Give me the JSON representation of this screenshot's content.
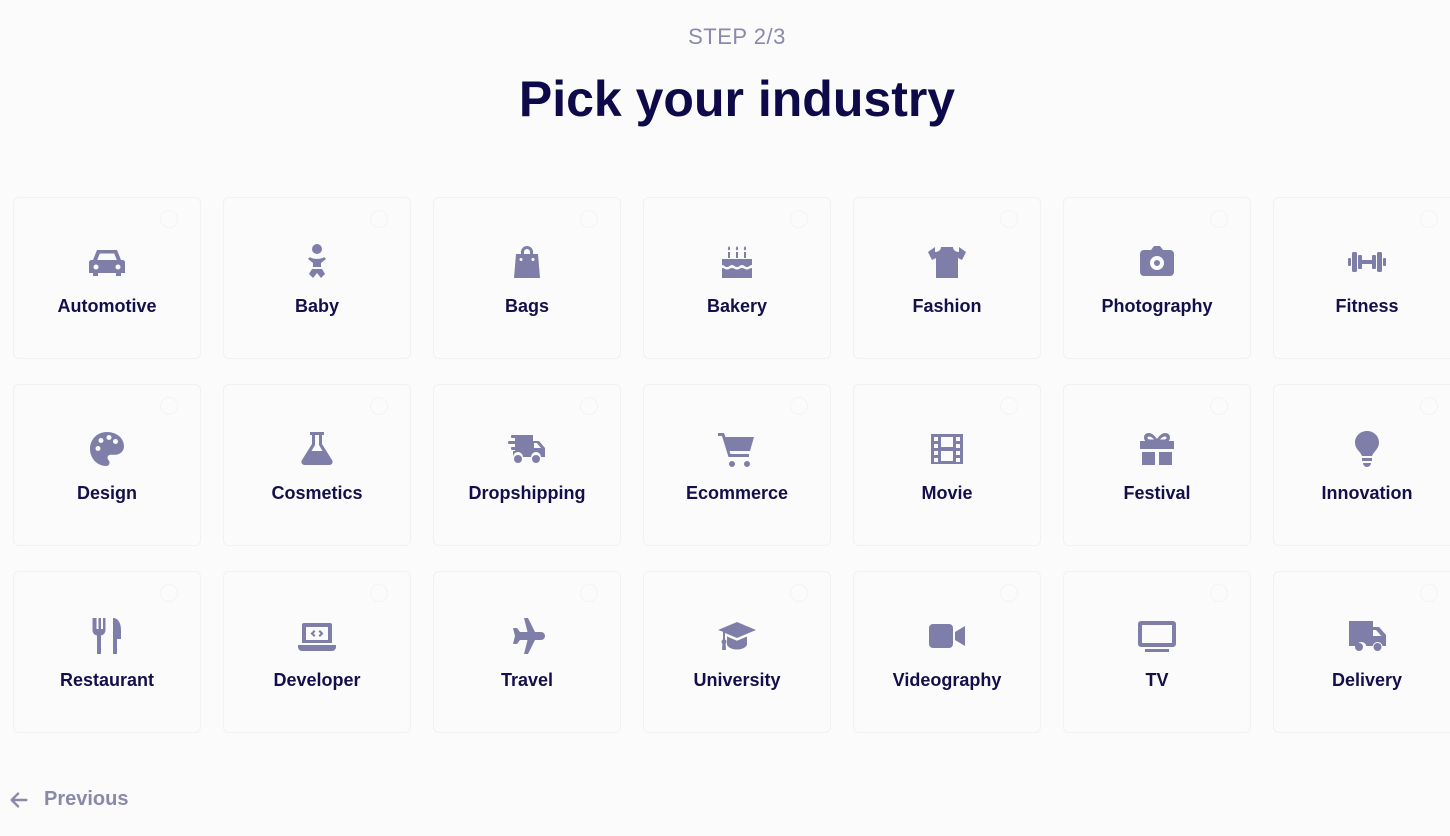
{
  "step": "STEP 2/3",
  "title": "Pick your industry",
  "colors": {
    "icon": "#7f7ea8",
    "title": "#0e0a4a",
    "muted": "#8a89aa"
  },
  "industries": [
    {
      "label": "Automotive",
      "icon": "car-icon"
    },
    {
      "label": "Baby",
      "icon": "baby-icon"
    },
    {
      "label": "Bags",
      "icon": "shopping-bag-icon"
    },
    {
      "label": "Bakery",
      "icon": "birthday-cake-icon"
    },
    {
      "label": "Fashion",
      "icon": "t-shirt-icon"
    },
    {
      "label": "Photography",
      "icon": "camera-icon"
    },
    {
      "label": "Fitness",
      "icon": "dumbbell-icon"
    },
    {
      "label": "Design",
      "icon": "palette-icon"
    },
    {
      "label": "Cosmetics",
      "icon": "flask-icon"
    },
    {
      "label": "Dropshipping",
      "icon": "shipping-fast-icon"
    },
    {
      "label": "Ecommerce",
      "icon": "shopping-cart-icon"
    },
    {
      "label": "Movie",
      "icon": "film-icon"
    },
    {
      "label": "Festival",
      "icon": "gift-icon"
    },
    {
      "label": "Innovation",
      "icon": "lightbulb-icon"
    },
    {
      "label": "Restaurant",
      "icon": "utensils-icon"
    },
    {
      "label": "Developer",
      "icon": "laptop-code-icon"
    },
    {
      "label": "Travel",
      "icon": "plane-icon"
    },
    {
      "label": "University",
      "icon": "graduation-cap-icon"
    },
    {
      "label": "Videography",
      "icon": "video-camera-icon"
    },
    {
      "label": "TV",
      "icon": "tv-icon"
    },
    {
      "label": "Delivery",
      "icon": "truck-icon"
    }
  ],
  "nav": {
    "previous_label": "Previous",
    "previous_icon": "arrow-left-icon"
  }
}
